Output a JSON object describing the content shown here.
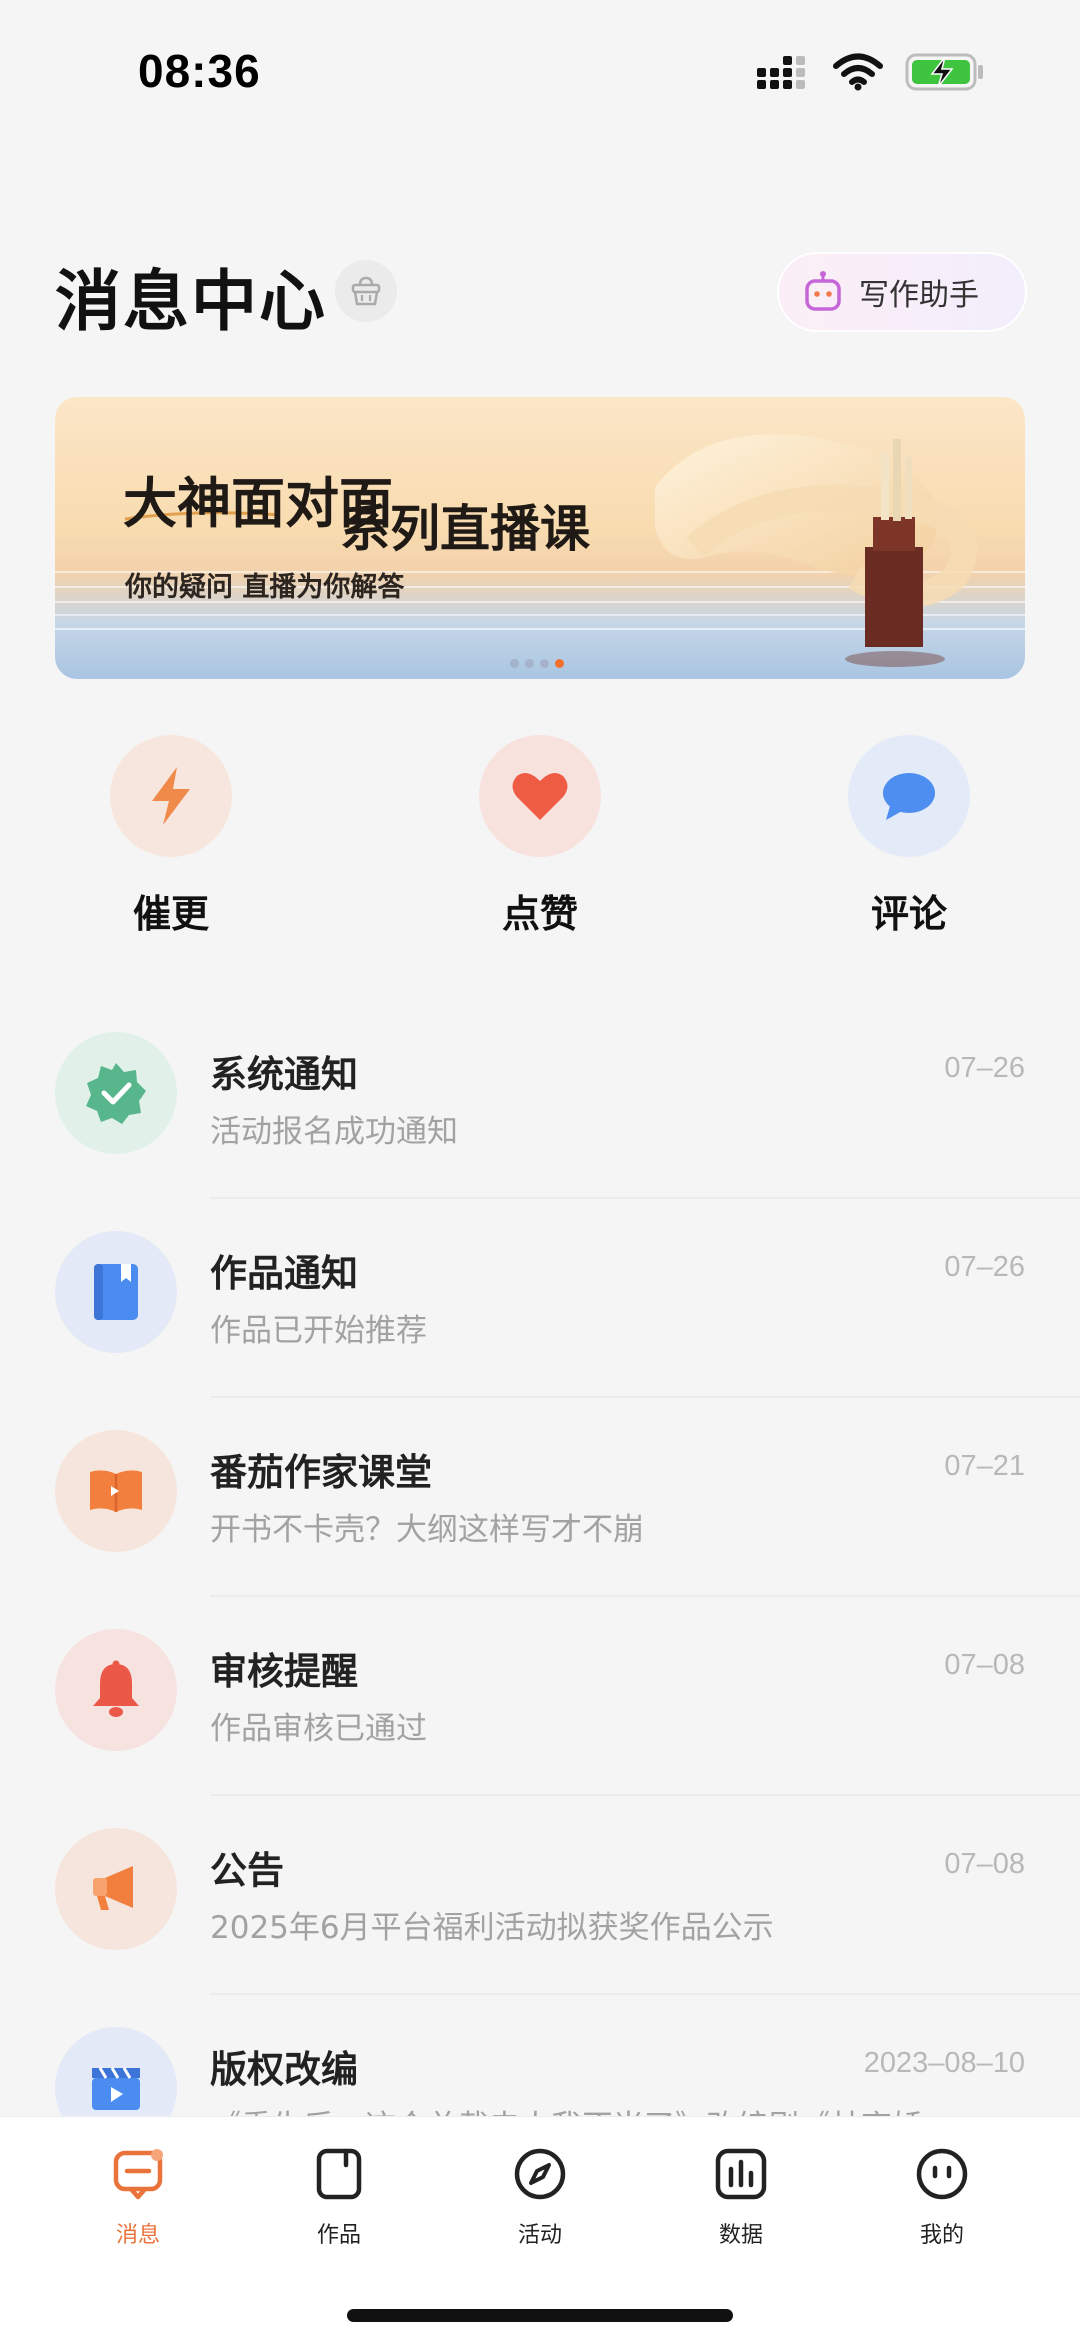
{
  "status_bar": {
    "time": "08:36"
  },
  "header": {
    "title": "消息中心",
    "assistant_label": "写作助手"
  },
  "banner": {
    "title_part1": "大神面对面",
    "title_part2": "系列直播课",
    "subtitle": "你的疑问 直播为你解答",
    "active_dot": 3,
    "dot_count": 4
  },
  "quick_actions": [
    {
      "label": "催更",
      "icon": "lightning-icon"
    },
    {
      "label": "点赞",
      "icon": "heart-icon"
    },
    {
      "label": "评论",
      "icon": "comment-icon"
    }
  ],
  "messages": [
    {
      "title": "系统通知",
      "subtitle": "活动报名成功通知",
      "date": "07–26",
      "icon": "verified-badge-icon"
    },
    {
      "title": "作品通知",
      "subtitle": "作品已开始推荐",
      "date": "07–26",
      "icon": "book-icon"
    },
    {
      "title": "番茄作家课堂",
      "subtitle": "开书不卡壳？大纲这样写才不崩",
      "date": "07–21",
      "icon": "open-book-icon"
    },
    {
      "title": "审核提醒",
      "subtitle": "作品审核已通过",
      "date": "07–08",
      "icon": "bell-icon"
    },
    {
      "title": "公告",
      "subtitle": "2025年6月平台福利活动拟获奖作品公示",
      "date": "07–08",
      "icon": "megaphone-icon"
    },
    {
      "title": "版权改编",
      "subtitle": "《重生后，这个总裁夫人我不当了》改编剧《林齐娇",
      "date": "2023–08–10",
      "icon": "clapperboard-icon"
    }
  ],
  "tabs": [
    {
      "label": "消息",
      "icon": "message-icon",
      "active": true
    },
    {
      "label": "作品",
      "icon": "works-icon",
      "active": false
    },
    {
      "label": "活动",
      "icon": "compass-icon",
      "active": false
    },
    {
      "label": "数据",
      "icon": "chart-icon",
      "active": false
    },
    {
      "label": "我的",
      "icon": "profile-icon",
      "active": false
    }
  ],
  "colors": {
    "accent": "#e9733a",
    "background": "#f5f5f5",
    "date_text": "#b8b8b8",
    "subtitle_text": "#a2a2a2"
  }
}
